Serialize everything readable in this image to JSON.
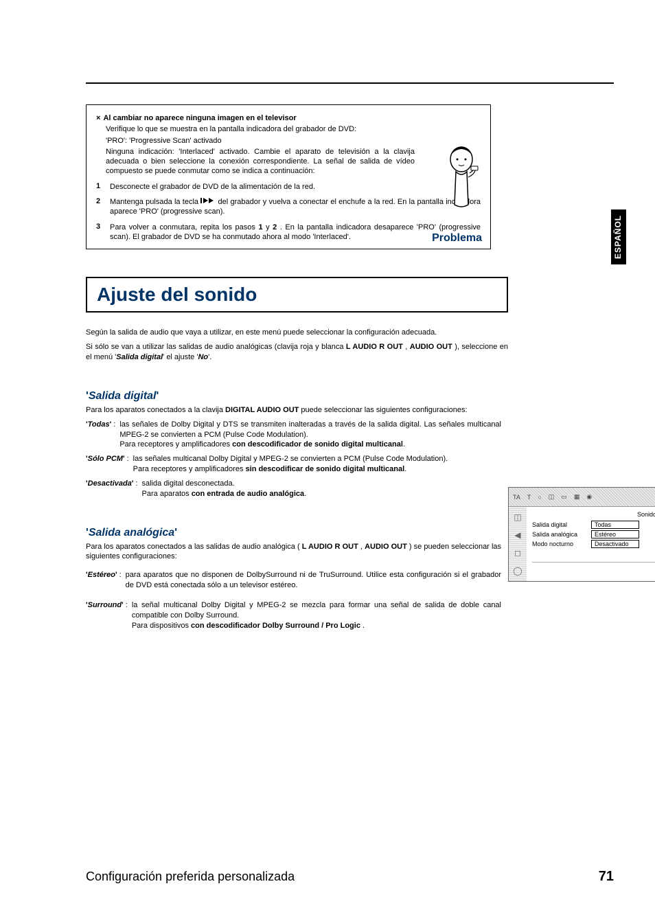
{
  "lang_tab": "ESPAÑOL",
  "problem": {
    "title_prefix": "×",
    "title": "Al cambiar no aparece ninguna imagen en el televisor",
    "para1": "Verifique lo que se muestra en la pantalla indicadora del grabador de DVD:",
    "para2": "'PRO': 'Progressive Scan' activado",
    "para3": "Ninguna indicación: 'Interlaced' activado. Cambie el aparato de televisión a la clavija adecuada o bien seleccione la conexión correspondiente. La señal de salida de vídeo compuesto se puede conmutar como se indica a continuación:",
    "step1_n": "1",
    "step1": "Desconecte el grabador de DVD de la alimentación de la red.",
    "step2_n": "2",
    "step2_a": "Mantenga pulsada la tecla ",
    "step2_b": " del grabador y vuelva a conectar el enchufe a la red. En la pantalla indicadora aparece 'PRO' (progressive scan).",
    "step3_n": "3",
    "step3_a": "Para volver a conmutara, repita los pasos ",
    "step3_b": " y ",
    "step3_c": " . En la pantalla indicadora desaparece 'PRO' (progressive scan). El grabador de DVD se ha conmutado ahora al modo 'Interlaced'.",
    "step3_bold1": "1",
    "step3_bold2": "2",
    "label": "Problema"
  },
  "section_title": "Ajuste del sonido",
  "intro": {
    "p1": "Según la salida de audio que vaya a utilizar, en este menú puede seleccionar la configuración adecuada.",
    "p2_a": "Si sólo se van a utilizar las salidas de audio analógicas (clavija roja y blanca ",
    "p2_b": "L AUDIO R OUT",
    "p2_c": " , ",
    "p2_d": "AUDIO OUT",
    "p2_e": " ), seleccione en el menú '",
    "p2_f": "Salida digital",
    "p2_g": "' el ajuste '",
    "p2_h": "No",
    "p2_i": "'."
  },
  "salida_digital": {
    "title": "Salida digital",
    "intro_a": "Para los aparatos conectados a la clavija ",
    "intro_b": "DIGITAL AUDIO OUT",
    "intro_c": " puede seleccionar las siguientes configuraciones:",
    "todas_term": "Todas",
    "todas_desc1": "las señales de Dolby Digital y DTS se transmiten inalteradas a través de la salida digital. Las señales multicanal MPEG-2 se convierten a PCM (Pulse Code Modulation).",
    "todas_desc2_a": "Para receptores y amplificadores ",
    "todas_desc2_b": "con descodificador de sonido digital multicanal",
    "todas_desc2_c": ".",
    "pcm_term": "Sólo PCM",
    "pcm_desc1": "las señales multicanal Dolby Digital y MPEG-2 se convierten a PCM (Pulse Code Modulation).",
    "pcm_desc2_a": "Para receptores y amplificadores ",
    "pcm_desc2_b": "sin descodificar de sonido digital multicanal",
    "pcm_desc2_c": ".",
    "des_term": "Desactivada",
    "des_desc1": "salida digital desconectada.",
    "des_desc2_a": "Para aparatos ",
    "des_desc2_b": "con entrada de audio analógica",
    "des_desc2_c": "."
  },
  "salida_analogica": {
    "title": "Salida analógica",
    "intro_a": "Para los aparatos conectados a las salidas de audio analógica ( ",
    "intro_b": "L AUDIO R OUT",
    "intro_c": " , ",
    "intro_d": "AUDIO OUT",
    "intro_e": " ) se pueden seleccionar las siguientes configuraciones:",
    "estereo_term": "Estéreo",
    "estereo_desc": "para aparatos que no disponen de DolbySurround ni de TruSurround. Utilice esta configuración si el grabador de DVD está conectada sólo a un televisor estéreo.",
    "surround_term": "Surround",
    "surround_desc1": "la señal multicanal Dolby Digital y MPEG-2 se mezcla para formar una señal de salida de doble canal compatible con Dolby Surround.",
    "surround_desc2_a": "Para dispositivos ",
    "surround_desc2_b": "con descodificador Dolby Surround / Pro Logic",
    "surround_desc2_c": " ."
  },
  "side_panel": {
    "tabs": [
      "TA",
      "T",
      "○",
      "◫",
      "▭",
      "▦",
      "◉"
    ],
    "header": "Sonido",
    "rows": [
      {
        "label": "Salida digital",
        "value": "Todas"
      },
      {
        "label": "Salida analógica",
        "value": "Estéreo"
      },
      {
        "label": "Modo nocturno",
        "value": "Desactivado"
      }
    ],
    "icons": [
      "◫",
      "◀",
      "◻",
      "◯"
    ]
  },
  "footer": {
    "title": "Configuración preferida personalizada",
    "page": "71"
  }
}
